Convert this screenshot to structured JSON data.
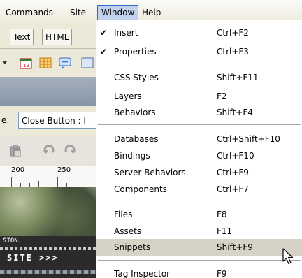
{
  "menubar": {
    "items": [
      {
        "label": "Commands"
      },
      {
        "label": "Site"
      },
      {
        "label": "Window"
      },
      {
        "label": "Help"
      }
    ]
  },
  "background": {
    "tabs": [
      {
        "label": "Text"
      },
      {
        "label": "HTML"
      }
    ],
    "properties_label": "e:",
    "selected_object": "Close Button : I",
    "ruler_numbers": [
      "200",
      "250"
    ],
    "banner_text_top": "SION.",
    "banner_text_main": "SITE >>>"
  },
  "window_menu": {
    "items": [
      {
        "label": "Insert",
        "shortcut": "Ctrl+F2",
        "checked": true,
        "check_mark": "✔"
      },
      {
        "label": "Properties",
        "shortcut": "Ctrl+F3",
        "checked": true,
        "check_mark": "✔"
      },
      {
        "label": "CSS Styles",
        "shortcut": "Shift+F11"
      },
      {
        "label": "Layers",
        "shortcut": "F2"
      },
      {
        "label": "Behaviors",
        "shortcut": "Shift+F4"
      },
      {
        "label": "Databases",
        "shortcut": "Ctrl+Shift+F10"
      },
      {
        "label": "Bindings",
        "shortcut": "Ctrl+F10"
      },
      {
        "label": "Server Behaviors",
        "shortcut": "Ctrl+F9"
      },
      {
        "label": "Components",
        "shortcut": "Ctrl+F7"
      },
      {
        "label": "Files",
        "shortcut": "F8"
      },
      {
        "label": "Assets",
        "shortcut": "F11"
      },
      {
        "label": "Snippets",
        "shortcut": "Shift+F9",
        "highlighted": true
      },
      {
        "label": "Tag Inspector",
        "shortcut": "F9"
      }
    ]
  },
  "colors": {
    "menu_highlight": "#d6d2c6",
    "menubar_active": "#c1d2ee",
    "menubar_active_border": "#316ac5"
  }
}
